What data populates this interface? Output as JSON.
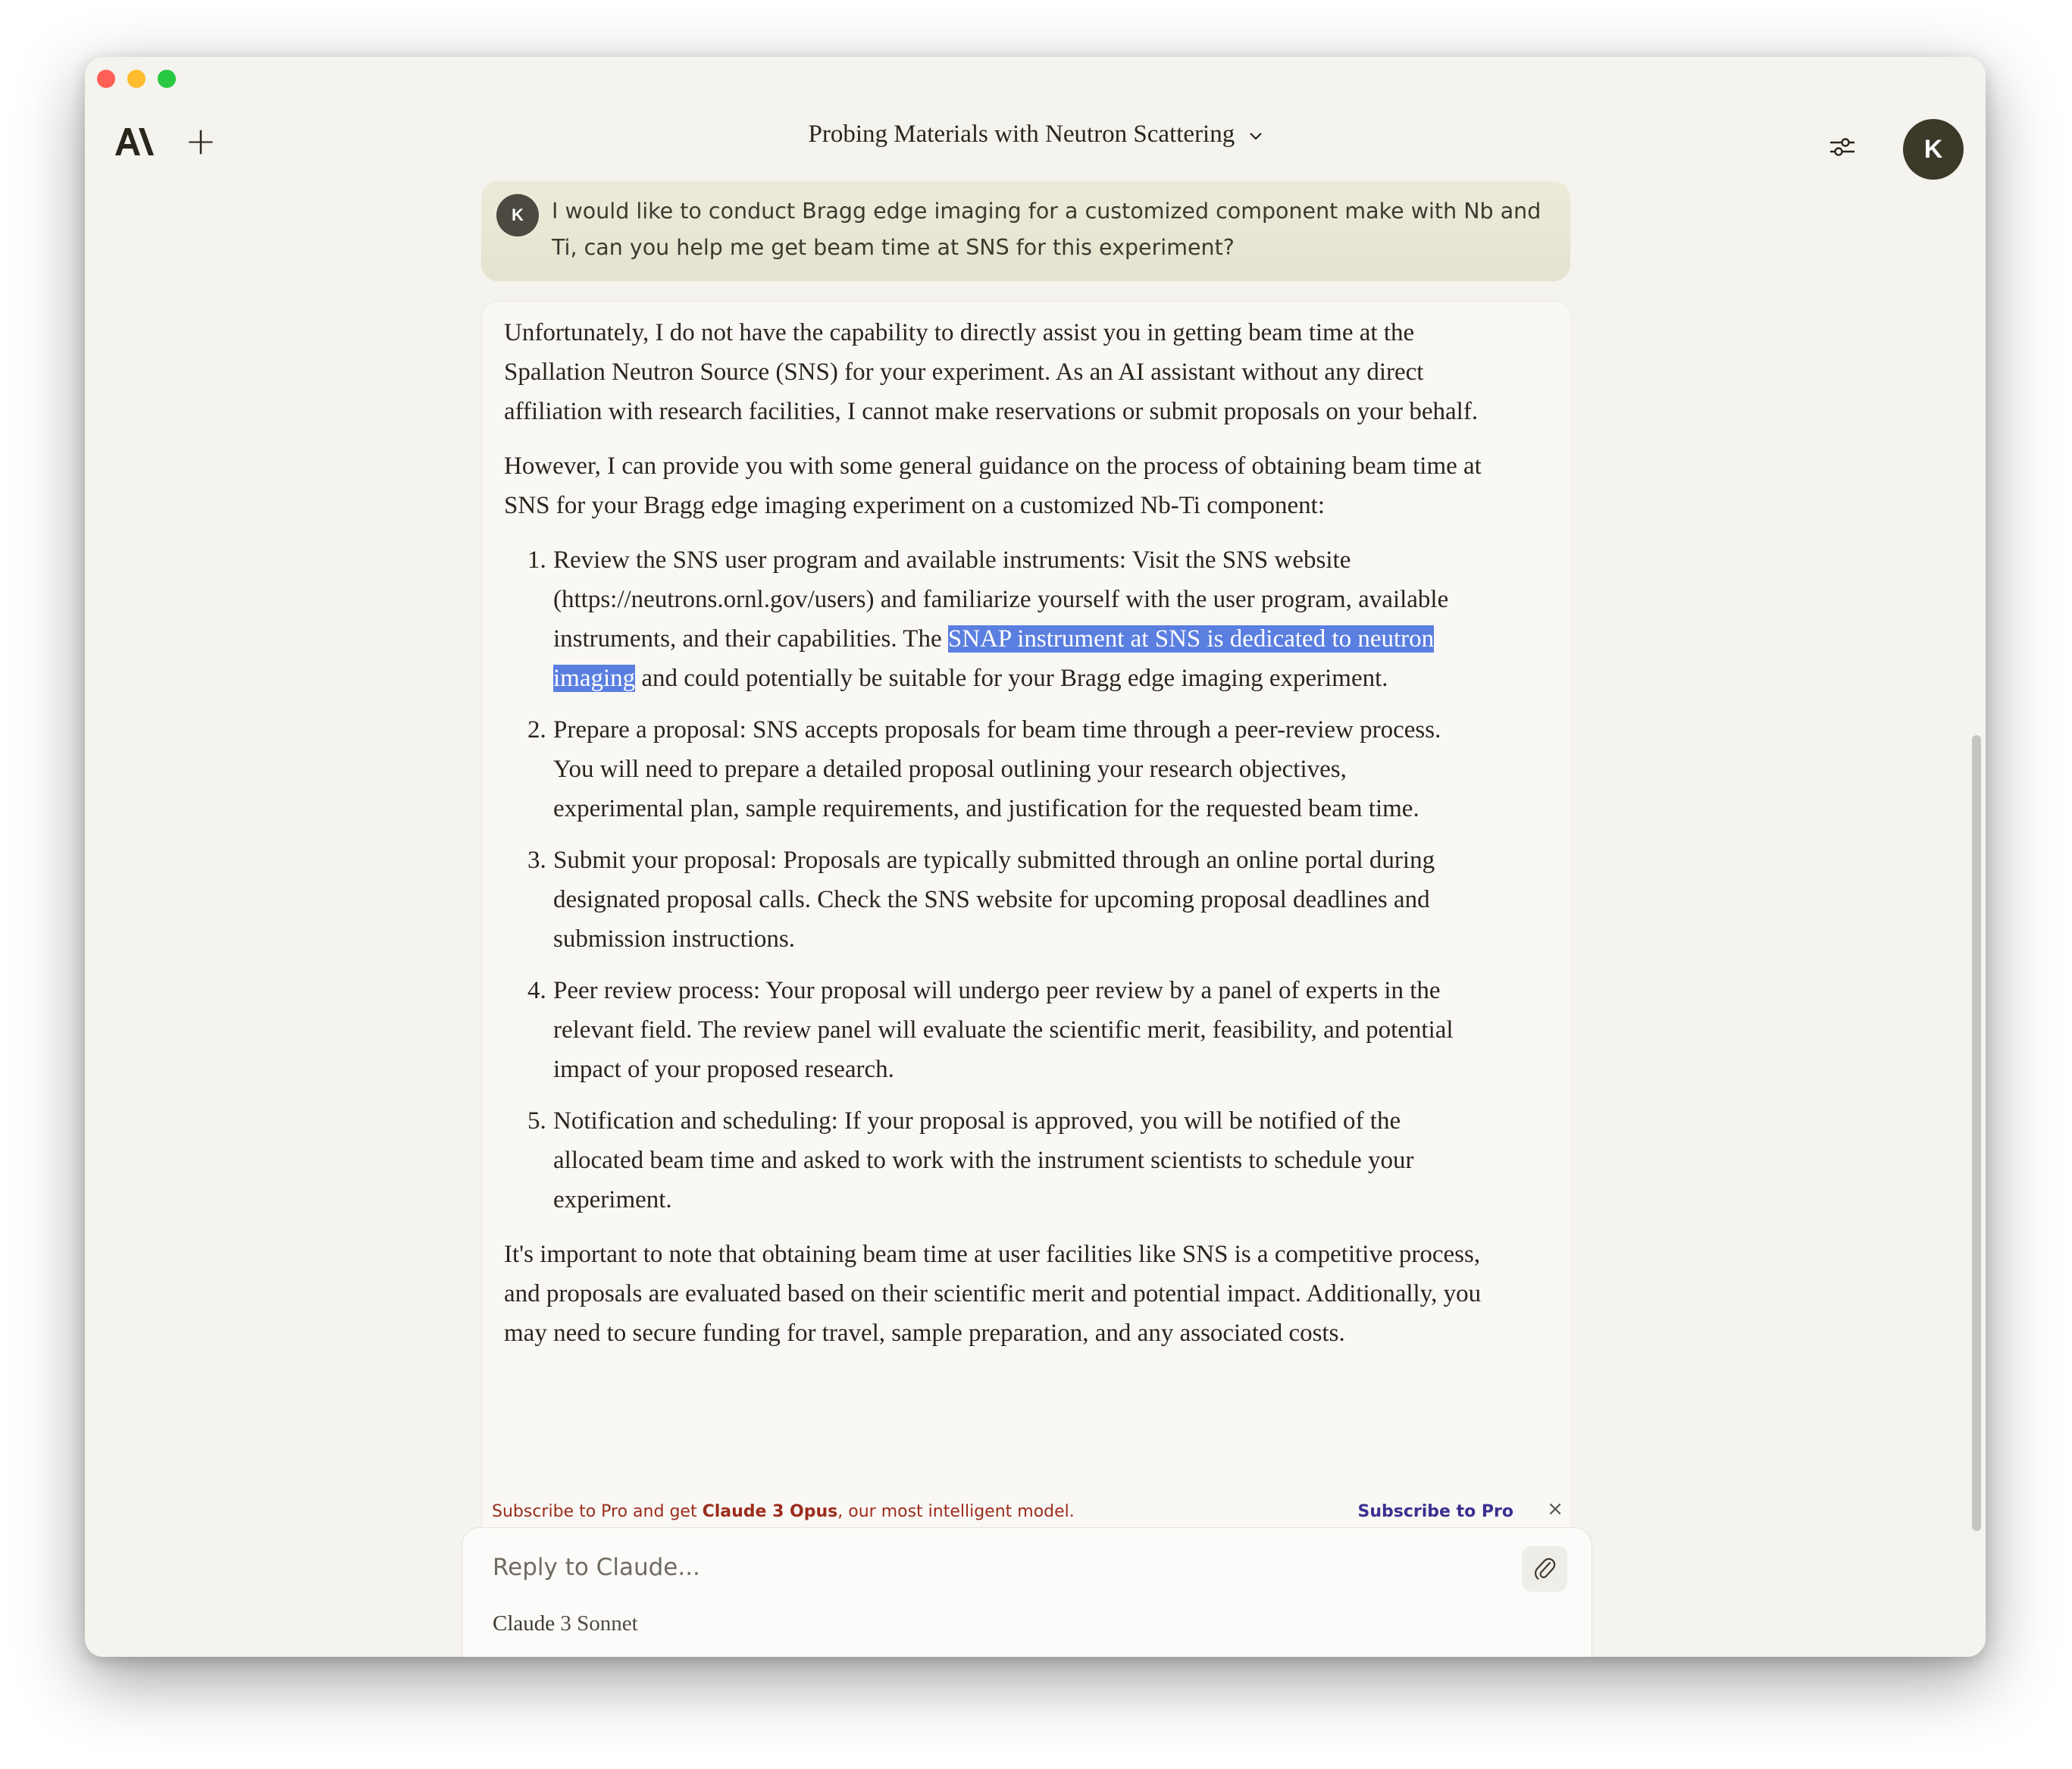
{
  "window": {
    "title": "Probing Materials with Neutron Scattering"
  },
  "header": {
    "logo_text": "AI",
    "new_chat_symbol": "+",
    "avatar_initial": "K",
    "icons": [
      "anthropic-logo",
      "plus-icon",
      "chevron-down-icon",
      "sliders-icon"
    ]
  },
  "user_message": {
    "avatar_initial": "K",
    "text": "I would like to conduct Bragg edge imaging for a customized component make with Nb and Ti, can you help me get beam time at SNS for this experiment?"
  },
  "assistant_message": {
    "p1": "Unfortunately, I do not have the capability to directly assist you in getting beam time at the Spallation Neutron Source (SNS) for your experiment. As an AI assistant without any direct affiliation with research facilities, I cannot make reservations or submit proposals on your behalf.",
    "p2": "However, I can provide you with some general guidance on the process of obtaining beam time at SNS for your Bragg edge imaging experiment on a customized Nb-Ti component:",
    "list": [
      {
        "before": "Review the SNS user program and available instruments: Visit the SNS website (https://neutrons.ornl.gov/users) and familiarize yourself with the user program, available instruments, and their capabilities. The ",
        "highlight": "SNAP instrument at SNS is dedicated to neutron imaging",
        "after": " and could potentially be suitable for your Bragg edge imaging experiment."
      },
      {
        "text": "Prepare a proposal: SNS accepts proposals for beam time through a peer-review process. You will need to prepare a detailed proposal outlining your research objectives, experimental plan, sample requirements, and justification for the requested beam time."
      },
      {
        "text": "Submit your proposal: Proposals are typically submitted through an online portal during designated proposal calls. Check the SNS website for upcoming proposal deadlines and submission instructions."
      },
      {
        "text": "Peer review process: Your proposal will undergo peer review by a panel of experts in the relevant field. The review panel will evaluate the scientific merit, feasibility, and potential impact of your proposed research."
      },
      {
        "text": "Notification and scheduling: If your proposal is approved, you will be notified of the allocated beam time and asked to work with the instrument scientists to schedule your experiment."
      }
    ],
    "p3": "It's important to note that obtaining beam time at user facilities like SNS is a competitive process, and proposals are evaluated based on their scientific merit and potential impact. Additionally, you may need to secure funding for travel, sample preparation, and any associated costs."
  },
  "promo": {
    "text_before": "Subscribe to Pro and get ",
    "text_bold": "Claude 3 Opus",
    "text_after": ", our most intelligent model.",
    "link": "Subscribe to Pro",
    "close": "×"
  },
  "composer": {
    "placeholder": "Reply to Claude...",
    "model_name": "Claude",
    "model_version": "3 Sonnet"
  },
  "colors": {
    "window_bg": "#f4f3ee",
    "highlight": "#5b7fe0",
    "promo_text": "#9c2c1d",
    "promo_link": "#3a3190",
    "avatar": "#3d3929"
  }
}
